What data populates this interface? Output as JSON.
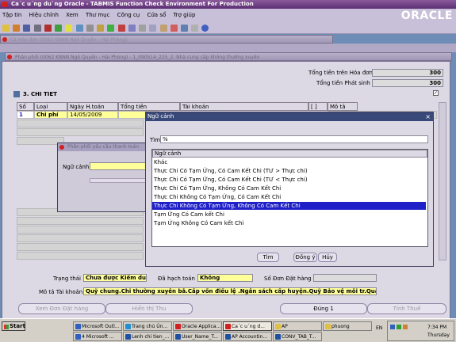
{
  "window": {
    "title": "Ca´c u´ng du`ng Oracle - TABMIS Function Check Environment For Production"
  },
  "menu": [
    "Tập tin",
    "Hiệu chỉnh",
    "Xem",
    "Thư mục",
    "Công cụ",
    "Cửa sổ",
    "Trợ giúp"
  ],
  "brand": "ORACLE",
  "bg_windows": {
    "w1": "Cá Hóa đơn (0062 KBNN Ngô Quyền - Hải Phòng)",
    "w2": "Phân phối (0062 KBNN Ngô Quyền - Hải Phòng) - 1_090514_225_2, Nhà cung cấp không thường xuyên"
  },
  "totals": {
    "invoice_label": "Tổng tiền trên Hóa đơn",
    "invoice_value": "300",
    "posted_label": "Tổng tiền Phát sinh",
    "posted_value": "300"
  },
  "section": {
    "title": "3. CHI TIET"
  },
  "grid": {
    "headers": [
      "Số",
      "Loại",
      "Ngày H.toán",
      "Tổng tiền",
      "Tài khoản",
      "[ ]",
      "Mô tả"
    ],
    "row1": {
      "no": "1",
      "type": "Chi phí",
      "date": "14/05/2009"
    }
  },
  "dist_dialog": {
    "title": "Phân phối yêu cầu thanh toán",
    "context_label": "Ngữ cảnh"
  },
  "lov": {
    "title": "Ngữ cảnh",
    "find_label": "Tìm",
    "find_value": "%",
    "column_header": "Ngữ cảnh",
    "items": [
      "Khác",
      "Thực Chi Có Tạm Ứng, Có Cam Kết Chi (TƯ > Thực chi)",
      "Thực Chi Có Tạm Ứng, Có Cam Kết Chi (TƯ < Thực chi)",
      "Thực Chi Có Tạm Ứng, Không Có Cam Kết Chi",
      "Thực Chi Không Có Tạm Ứng, Có Cam Kết Chi",
      "Thực Chi Không Có Tạm Ứng, Không Có Cam Kết Chi",
      "Tạm Ứng Có Cam kết Chi",
      "Tạm Ứng Không Có Cam kết Chi"
    ],
    "selected_index": 5,
    "buttons": {
      "find": "Tìm",
      "ok": "Đồng ý",
      "cancel": "Hủy"
    }
  },
  "status": {
    "state_label": "Trạng thái",
    "state_value": "Chưa được Kiểm duyệt",
    "accounted_label": "Đã hạch toán",
    "accounted_value": "Không",
    "po_label": "Số Đơn Đặt hàng",
    "desc_label": "Mô tả Tài khoản",
    "desc_value": "Quỹ chung.Chi thường xuyên bằ.Cấp vốn điều lệ .Ngân sách cấp huyện.Quỹ Bảo vệ môi tr.Quận Ngô Q"
  },
  "bottom_buttons": [
    "Xem Đơn Đặt hàng",
    "Hiển thị Thu",
    "Đúng 1",
    "Tính Thuế"
  ],
  "taskbar": {
    "start": "Start",
    "row1": [
      "Microsoft Outl...",
      "Trang chủ Ún...",
      "Oracle Applica...",
      "Ca´c u´ng d...",
      "AP",
      "phuong"
    ],
    "row2": [
      "4 Microsoft ...",
      "Lenh chi tien_...",
      "User_Name_T...",
      "AP Accountin...",
      "CONV_TAB_T..."
    ],
    "lang": "EN",
    "time": "7:34 PM",
    "day": "Thursday"
  }
}
